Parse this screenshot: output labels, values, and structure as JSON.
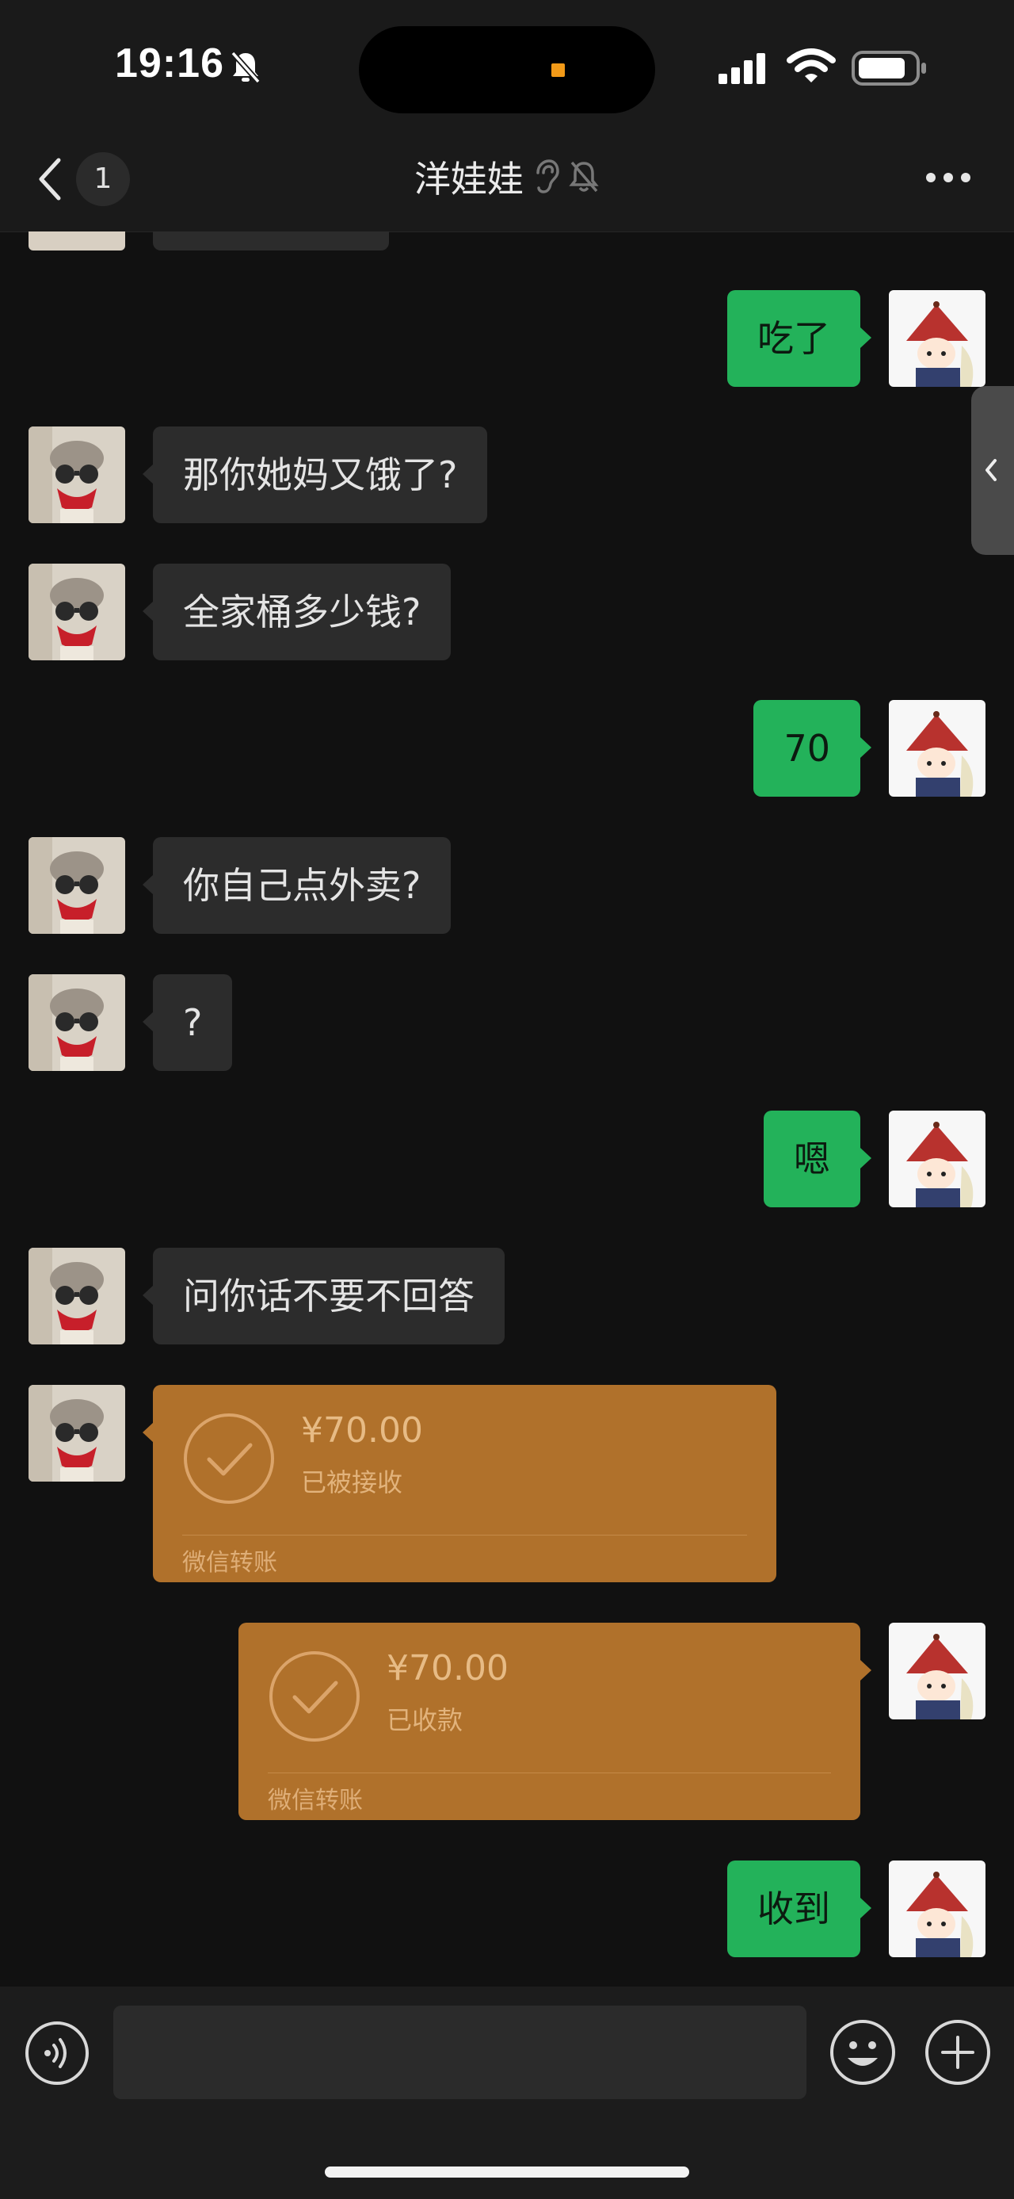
{
  "status_bar": {
    "time": "19:16",
    "battery_icon": "battery-icon",
    "wifi_icon": "wifi-icon",
    "signal_icon": "signal-icon",
    "mute_icon": "bell-slash-icon"
  },
  "nav": {
    "back_count": "1",
    "title": "洋娃娃",
    "more_icon": "more-icon"
  },
  "messages": [
    {
      "from": "me",
      "text": "吃了"
    },
    {
      "from": "them",
      "text": "那你她妈又饿了?"
    },
    {
      "from": "them",
      "text": "全家桶多少钱?"
    },
    {
      "from": "me",
      "text": "70"
    },
    {
      "from": "them",
      "text": "你自己点外卖?"
    },
    {
      "from": "them",
      "text": "?"
    },
    {
      "from": "me",
      "text": "嗯"
    },
    {
      "from": "them",
      "text": "问你话不要不回答"
    },
    {
      "from": "them",
      "type": "transfer",
      "amount": "¥70.00",
      "status": "已被接收",
      "footer": "微信转账"
    },
    {
      "from": "me",
      "type": "transfer",
      "amount": "¥70.00",
      "status": "已收款",
      "footer": "微信转账"
    },
    {
      "from": "me",
      "text": "收到"
    }
  ],
  "colors": {
    "bg": "#111111",
    "bubble_in": "#2c2c2c",
    "bubble_out": "#23b25a",
    "transfer": "#b0712b"
  }
}
